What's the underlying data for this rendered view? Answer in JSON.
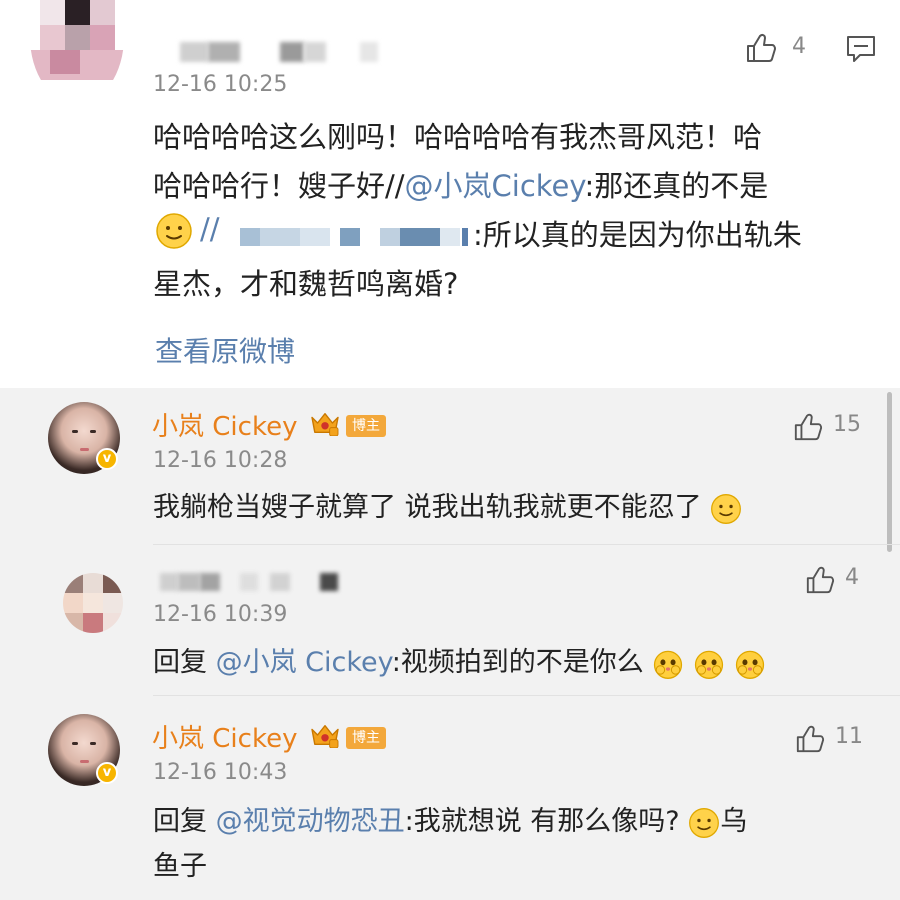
{
  "main_comment": {
    "time": "12-16 10:25",
    "like_count": "4",
    "lines": [
      "哈哈哈哈这么刚吗！哈哈哈哈有我杰哥风范！哈",
      "哈哈哈行！嫂子好//"
    ],
    "mention_1": "@小岚Cickey",
    "after_mention_1": ":那还真的不是",
    "sep": "//",
    "after_blur": ":所以真的是因为你出轨朱",
    "last_line": "星杰，才和魏哲鸣离婚?",
    "view_original": "查看原微博"
  },
  "replies": [
    {
      "name": "小岚 Cickey",
      "badge": "博主",
      "time": "12-16 10:28",
      "like_count": "15",
      "text": "我躺枪当嫂子就算了 说我出轨我就更不能忍了"
    },
    {
      "time": "12-16 10:39",
      "like_count": "4",
      "reply_prefix": "回复 ",
      "mention": "@小岚 Cickey",
      "text": ":视频拍到的不是你么"
    },
    {
      "name": "小岚 Cickey",
      "badge": "博主",
      "time": "12-16 10:43",
      "like_count": "11",
      "reply_prefix": "回复 ",
      "mention": "@视觉动物恐丑",
      "text": ":我就想说 有那么像吗?",
      "tail_1": "乌",
      "tail_2": "鱼子"
    }
  ],
  "icons": {
    "like": "thumbs-up-icon",
    "comment": "comment-icon",
    "smile": "smile-emoji-icon",
    "shy": "shy-emoji-icon",
    "verified": "verified-v-icon",
    "crown": "crown-badge-icon"
  },
  "colors": {
    "name": "#e8801b",
    "mention": "#5a7fad",
    "badge": "#f3a83b",
    "reply_bg": "#f2f2f2"
  }
}
